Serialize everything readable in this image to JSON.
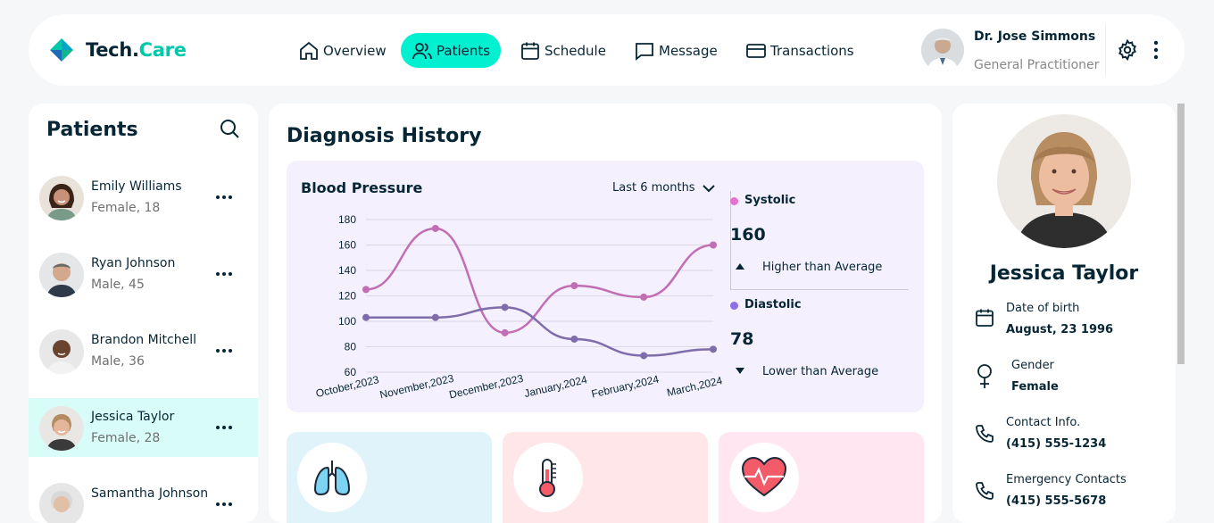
{
  "app": {
    "brand_part1": "Tech.",
    "brand_part2": "Care"
  },
  "nav": {
    "items": [
      {
        "label": "Overview",
        "icon": "home-icon",
        "active": false
      },
      {
        "label": "Patients",
        "icon": "users-icon",
        "active": true
      },
      {
        "label": "Schedule",
        "icon": "calendar-icon",
        "active": false
      },
      {
        "label": "Message",
        "icon": "chat-icon",
        "active": false
      },
      {
        "label": "Transactions",
        "icon": "credit-card-icon",
        "active": false
      }
    ]
  },
  "doctor": {
    "name": "Dr. Jose Simmons",
    "role": "General Practitioner"
  },
  "patients": {
    "title": "Patients",
    "list": [
      {
        "name": "Emily Williams",
        "info": "Female, 18",
        "active": false
      },
      {
        "name": "Ryan Johnson",
        "info": "Male, 45",
        "active": false
      },
      {
        "name": "Brandon Mitchell",
        "info": "Male, 36",
        "active": false
      },
      {
        "name": "Jessica Taylor",
        "info": "Female, 28",
        "active": true
      },
      {
        "name": "Samantha Johnson",
        "info": "",
        "active": false
      }
    ]
  },
  "diagnosis": {
    "title": "Diagnosis History",
    "bp_title": "Blood Pressure",
    "period": "Last 6 months",
    "systolic": {
      "label": "Systolic",
      "value": "160",
      "note": "Higher than Average",
      "color": "#E66FD2"
    },
    "diastolic": {
      "label": "Diastolic",
      "value": "78",
      "note": "Lower than Average",
      "color": "#8C6FE6"
    }
  },
  "chart_data": {
    "type": "line",
    "title": "Blood Pressure",
    "categories": [
      "October,2023",
      "November,2023",
      "December,2023",
      "January,2024",
      "February,2024",
      "March,2024"
    ],
    "series": [
      {
        "name": "Systolic",
        "color": "#C26EB4",
        "values": [
          125,
          173,
          91,
          128,
          119,
          160
        ]
      },
      {
        "name": "Diastolic",
        "color": "#7E6CAB",
        "values": [
          103,
          103,
          111,
          86,
          73,
          78
        ]
      }
    ],
    "yticks": [
      60,
      80,
      100,
      120,
      140,
      160,
      180
    ],
    "ylim": [
      60,
      180
    ],
    "grid": true
  },
  "profile": {
    "name": "Jessica Taylor",
    "fields": [
      {
        "label": "Date of birth",
        "value": "August, 23 1996",
        "icon": "calendar-icon"
      },
      {
        "label": "Gender",
        "value": "Female",
        "icon": "female-icon"
      },
      {
        "label": "Contact Info.",
        "value": "(415) 555-1234",
        "icon": "phone-icon"
      },
      {
        "label": "Emergency Contacts",
        "value": "(415) 555-5678",
        "icon": "phone-icon"
      }
    ]
  },
  "vitals": [
    {
      "icon": "lungs-icon",
      "bg": "#E0F3FA"
    },
    {
      "icon": "thermometer-icon",
      "bg": "#FFE6E9"
    },
    {
      "icon": "heart-icon",
      "bg": "#FFE6F1"
    }
  ]
}
